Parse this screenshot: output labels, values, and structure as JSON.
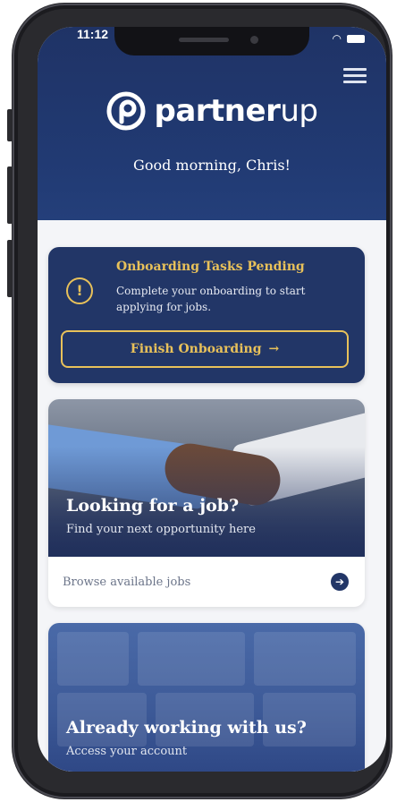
{
  "status_bar": {
    "time": "11:12"
  },
  "header": {
    "logo_bold": "partner",
    "logo_light": "up",
    "greeting": "Good morning, Chris!"
  },
  "onboarding": {
    "title": "Onboarding Tasks Pending",
    "text": "Complete your onboarding to start applying for jobs.",
    "button_label": "Finish Onboarding",
    "button_arrow": "→",
    "icon_glyph": "!"
  },
  "job_card": {
    "title": "Looking for a job?",
    "subtitle": "Find your next opportunity here",
    "link_label": "Browse available jobs",
    "link_arrow": "➔"
  },
  "account_card": {
    "title": "Already working with us?",
    "subtitle": "Access your account"
  },
  "colors": {
    "navy": "#223667",
    "accent": "#e8c15a",
    "background": "#f4f5f8"
  },
  "icons": [
    "menu-icon",
    "warning-icon",
    "arrow-right-icon",
    "battery-icon",
    "wifi-icon"
  ]
}
